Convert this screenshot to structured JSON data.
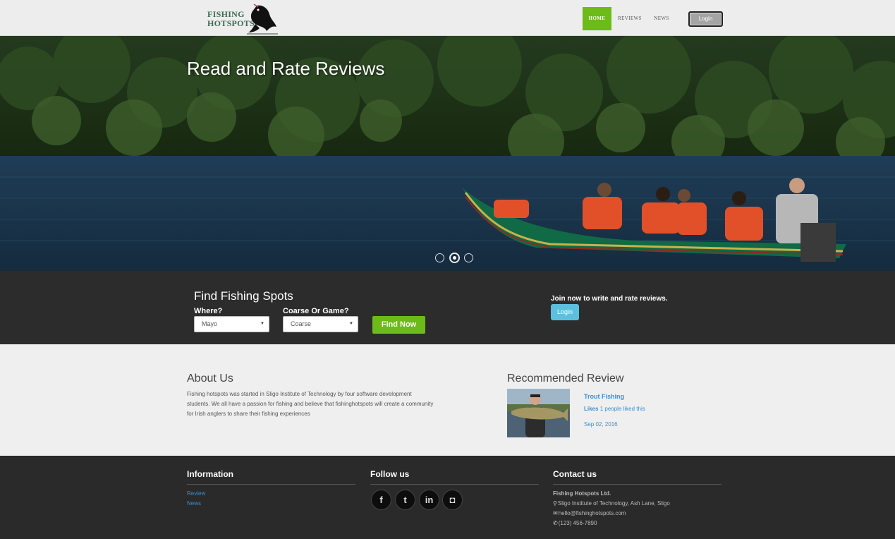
{
  "brand": {
    "line1": "FISHING",
    "line2": "HOTSPOTS"
  },
  "nav": {
    "home": "HOME",
    "reviews": "REVIEWS",
    "news": "NEWS",
    "login": "Login"
  },
  "hero": {
    "title": "Read and Rate Reviews",
    "slides": 3,
    "active_slide": 2
  },
  "search": {
    "title": "Find Fishing Spots",
    "where_label": "Where?",
    "where_value": "Mayo",
    "type_label": "Coarse Or Game?",
    "type_value": "Coarse",
    "button": "Find Now",
    "join_text": "Join now to write and rate reviews.",
    "join_button": "Login"
  },
  "about": {
    "title": "About Us",
    "text": "Fishing hotspots was started in Sligo Institute of Technology by four software development students. We all have a passion for fishing and believe that fishinghotspots will create a community for Irish anglers to share their fishing experiences"
  },
  "recommended": {
    "title": "Recommended Review",
    "name": "Trout Fishing",
    "likes_label": "Likes",
    "likes_text": "1 people liked this",
    "date": "Sep 02, 2016"
  },
  "footer": {
    "info_title": "Information",
    "links": [
      "Review",
      "News"
    ],
    "follow_title": "Follow us",
    "social": [
      {
        "icon": "facebook-icon",
        "glyph": "f"
      },
      {
        "icon": "twitter-icon",
        "glyph": "t"
      },
      {
        "icon": "linkedin-icon",
        "glyph": "in"
      },
      {
        "icon": "instagram-icon",
        "glyph": "◘"
      }
    ],
    "contact_title": "Contact us",
    "company": "Fishing Hotspots Ltd.",
    "address": "Sligo Institute of Technology, Ash Lane, Sligo",
    "email": "hello@fishinghotspots.com",
    "phone": "(123) 456-7890"
  },
  "colors": {
    "accent_green": "#6cbb18",
    "info_blue": "#5bc0de",
    "link_blue": "#3b8ed3",
    "dark_band": "#2c2c2c"
  }
}
